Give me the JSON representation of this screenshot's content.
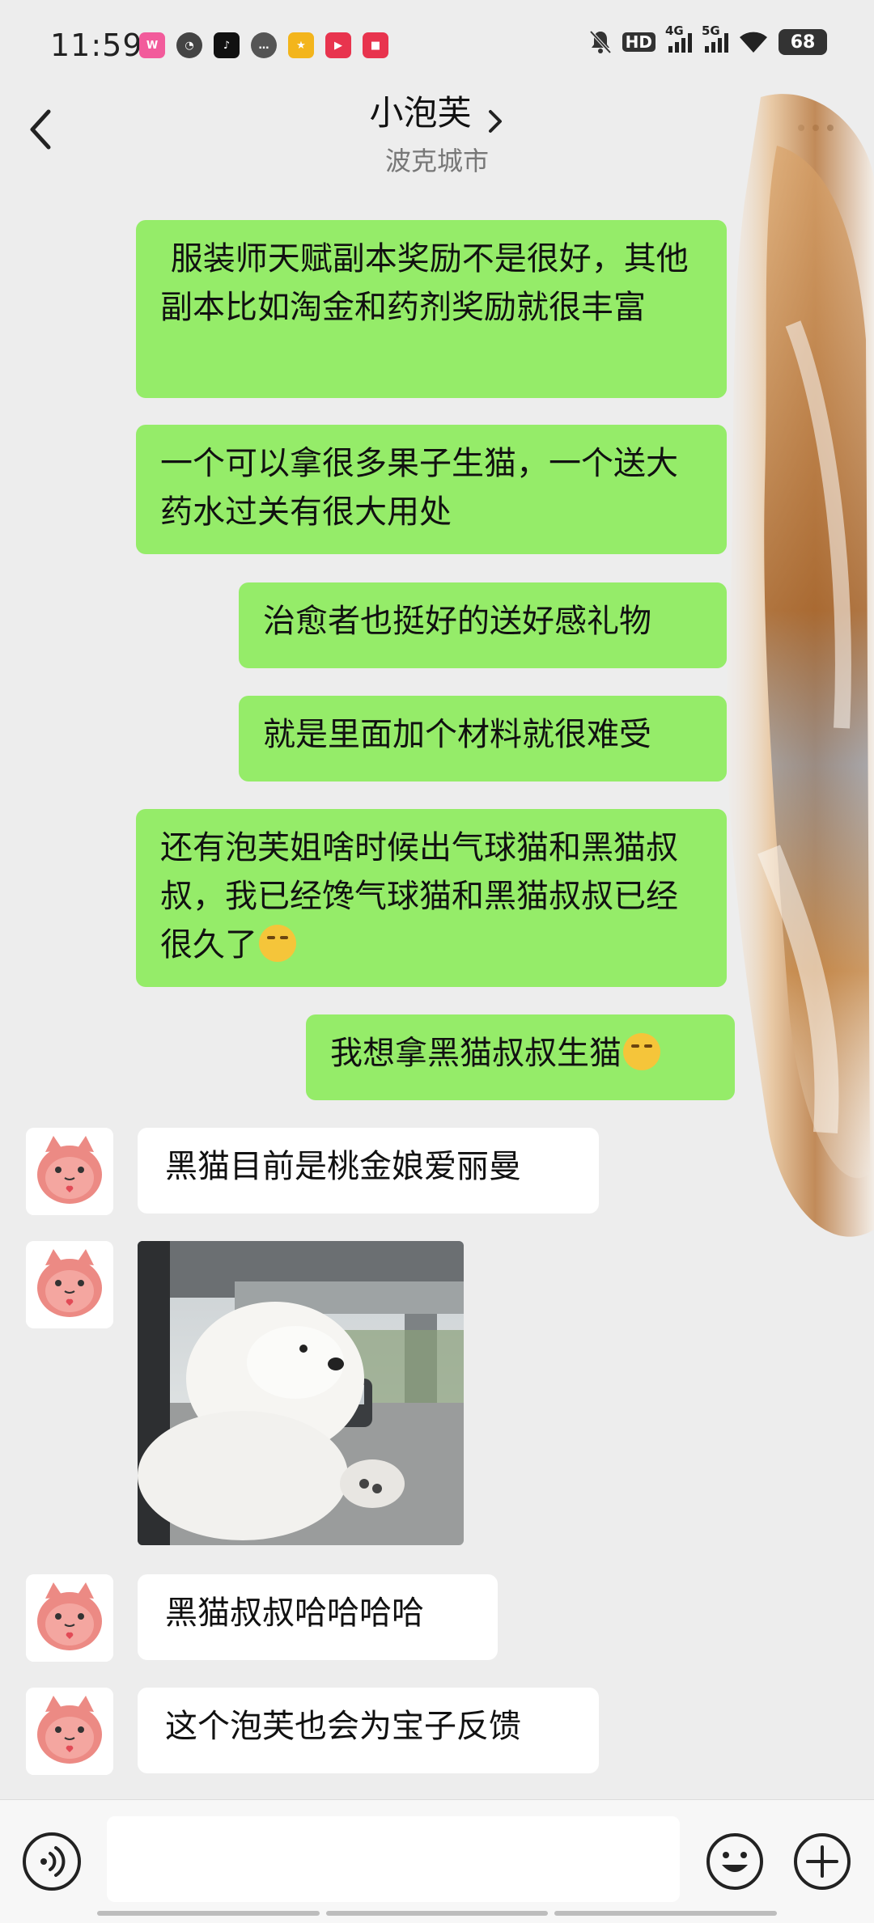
{
  "status_bar": {
    "time": "11:59",
    "network_hd": "HD",
    "network_4g": "4G",
    "network_5g": "5G",
    "battery": "68",
    "app_icons": [
      "weibo-icon",
      "speedometer-icon",
      "tiktok-icon",
      "chat-bubble-icon",
      "food-app-icon",
      "video-app-icon",
      "shop-app-icon"
    ]
  },
  "header": {
    "title": "小泡芙",
    "subtitle": "波克城市"
  },
  "messages": {
    "out_1": " 服装师天赋副本奖励不是很好，其他副本比如淘金和药剂奖励就很丰富",
    "out_2": "一个可以拿很多果子生猫，一个送大药水过关有很大用处",
    "out_3": "治愈者也挺好的送好感礼物",
    "out_4": "就是里面加个材料就很难受",
    "out_5": "还有泡芙姐啥时候出气球猫和黑猫叔叔，我已经馋气球猫和黑猫叔叔已经很久了",
    "out_6": "我想拿黑猫叔叔生猫",
    "in_1": "黑猫目前是桃金娘爱丽曼",
    "in_3": "黑猫叔叔哈哈哈哈",
    "in_4": "这个泡芙也会为宝子反馈"
  },
  "colors": {
    "outgoing_bubble": "#95ec69",
    "incoming_bubble": "#ffffff",
    "background": "#ededed"
  },
  "input": {
    "value": "",
    "placeholder": ""
  }
}
